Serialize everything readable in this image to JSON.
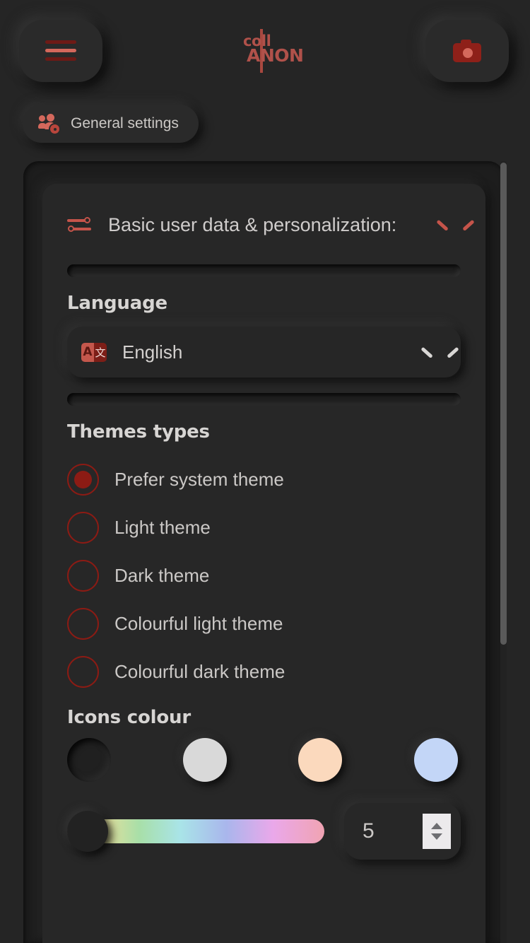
{
  "app": {
    "logo_top": "coll",
    "logo_bottom": "ANON",
    "accent": "#c5544a",
    "accent_dark": "#8c1b14",
    "background": "#252525"
  },
  "topbar": {
    "menu_button_label": "menu",
    "camera_button_label": "camera"
  },
  "breadcrumb": {
    "label": "General settings"
  },
  "section": {
    "title": "Basic user data & personalization:",
    "expanded": true
  },
  "language": {
    "label": "Language",
    "selected": "English",
    "icon_left_char": "A",
    "icon_right_char": "文"
  },
  "themes": {
    "label": "Themes types",
    "options": [
      {
        "label": "Prefer system theme",
        "checked": true
      },
      {
        "label": "Light theme",
        "checked": false
      },
      {
        "label": "Dark theme",
        "checked": false
      },
      {
        "label": "Colourful light theme",
        "checked": false
      },
      {
        "label": "Colourful dark theme",
        "checked": false
      }
    ]
  },
  "icons_colour": {
    "label": "Icons colour",
    "swatches": [
      {
        "name": "swatch-dark",
        "color": "#202020",
        "selected": true
      },
      {
        "name": "swatch-light",
        "color": "#d9d9d9",
        "selected": false
      },
      {
        "name": "swatch-peach",
        "color": "#fbd9bd",
        "selected": false
      },
      {
        "name": "swatch-blue",
        "color": "#c3d6f7",
        "selected": false
      }
    ],
    "slider_value_percent": 0,
    "number_value": "5",
    "gradient_stops": [
      "#e9a09a",
      "#eedf9a",
      "#a8dfa8",
      "#a9e4e8",
      "#a9b6ec",
      "#eaa8ea",
      "#f0a3b2"
    ]
  }
}
